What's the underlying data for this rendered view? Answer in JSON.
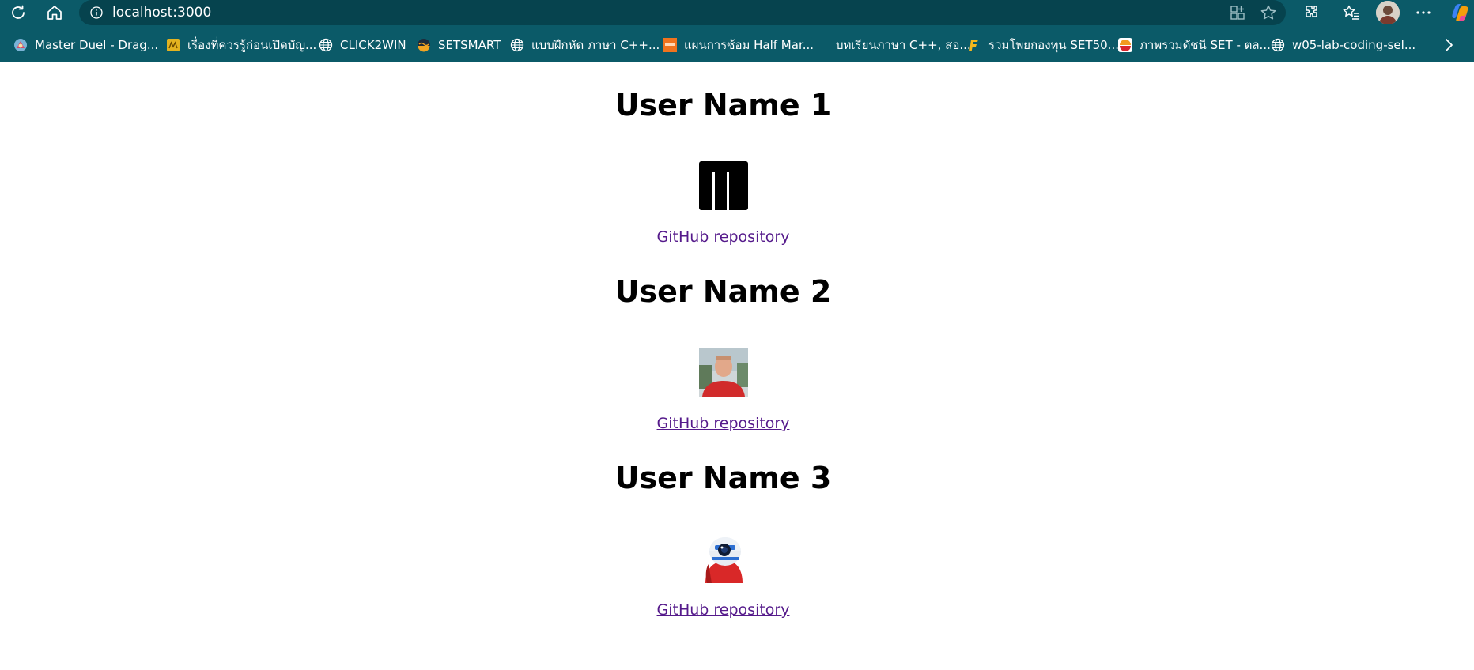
{
  "browser": {
    "url": "localhost:3000",
    "theme_color": "#0b5a68",
    "bookmarks": [
      {
        "label": "Master Duel - Drag...",
        "icon": "game-icon"
      },
      {
        "label": "เรื่องที่ควรรู้ก่อนเปิดบัญ...",
        "icon": "bank-icon"
      },
      {
        "label": "CLICK2WIN",
        "icon": "globe-icon"
      },
      {
        "label": "SETSMART",
        "icon": "setsmart-icon"
      },
      {
        "label": "แบบฝึกหัด ภาษา C++...",
        "icon": "globe-icon"
      },
      {
        "label": "แผนการซ้อม Half Mar...",
        "icon": "orange-site-icon"
      },
      {
        "label": "บทเรียนภาษา C++, สอ...",
        "icon": "blank-icon"
      },
      {
        "label": "รวมโพยกองทุน SET50...",
        "icon": "f-logo-icon"
      },
      {
        "label": "ภาพรวมดัชนี SET - ตล...",
        "icon": "set-logo-icon"
      },
      {
        "label": "w05-lab-coding-sel...",
        "icon": "globe-icon"
      }
    ]
  },
  "users": [
    {
      "name": "User Name 1",
      "avatar": "black-block-logo",
      "link_label": "GitHub repository"
    },
    {
      "name": "User Name 2",
      "avatar": "photo-red-shirt",
      "link_label": "GitHub repository"
    },
    {
      "name": "User Name 3",
      "avatar": "r2d2-hoodie",
      "link_label": "GitHub repository"
    }
  ],
  "colors": {
    "link_visited": "#551a8b",
    "heading": "#000000"
  }
}
